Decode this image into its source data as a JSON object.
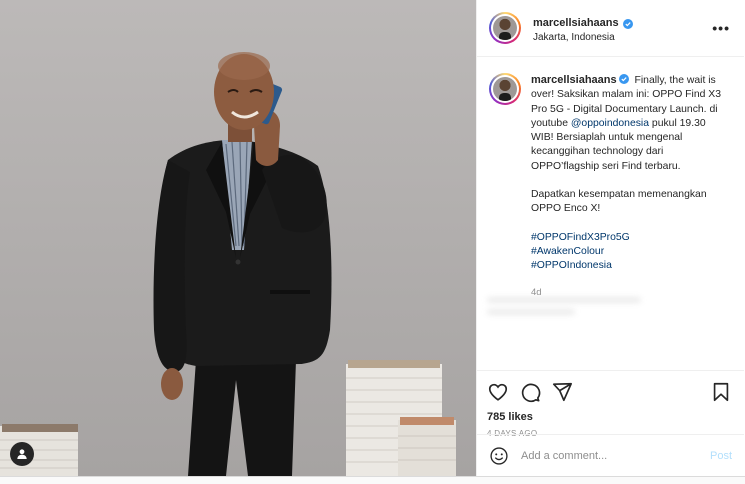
{
  "header": {
    "username": "marcellsiahaans",
    "location": "Jakarta, Indonesia",
    "more_label": "•••"
  },
  "caption": {
    "username": "marcellsiahaans",
    "text_1": "Finally, the wait is over! Saksikan malam ini: OPPO Find X3 Pro 5G - Digital Documentary Launch. di youtube",
    "mention": "@oppoindonesia",
    "text_2": "pukul 19.30 WIB! Bersiaplah untuk mengenal kecanggihan technology dari OPPO’flagship seri Find terbaru.",
    "text_3": "Dapatkan kesempatan memenangkan OPPO Enco X!",
    "hashtags": [
      "#OPPOFindX3Pro5G",
      "#AwakenColour",
      "#OPPOIndonesia"
    ],
    "age": "4d"
  },
  "stats": {
    "likes": "785 likes",
    "date": "4 DAYS AGO"
  },
  "comment_box": {
    "placeholder": "Add a comment...",
    "post_label": "Post"
  },
  "icons": {
    "like": "heart-icon",
    "comment": "comment-icon",
    "share": "paper-plane-icon",
    "save": "bookmark-icon",
    "emoji": "emoji-icon",
    "verified": "verified-badge-icon",
    "tag": "user-tag-icon"
  },
  "colors": {
    "verified": "#3897f0",
    "link": "#00376b",
    "muted": "#8e8e8e",
    "post_disabled": "#b2dffc"
  }
}
